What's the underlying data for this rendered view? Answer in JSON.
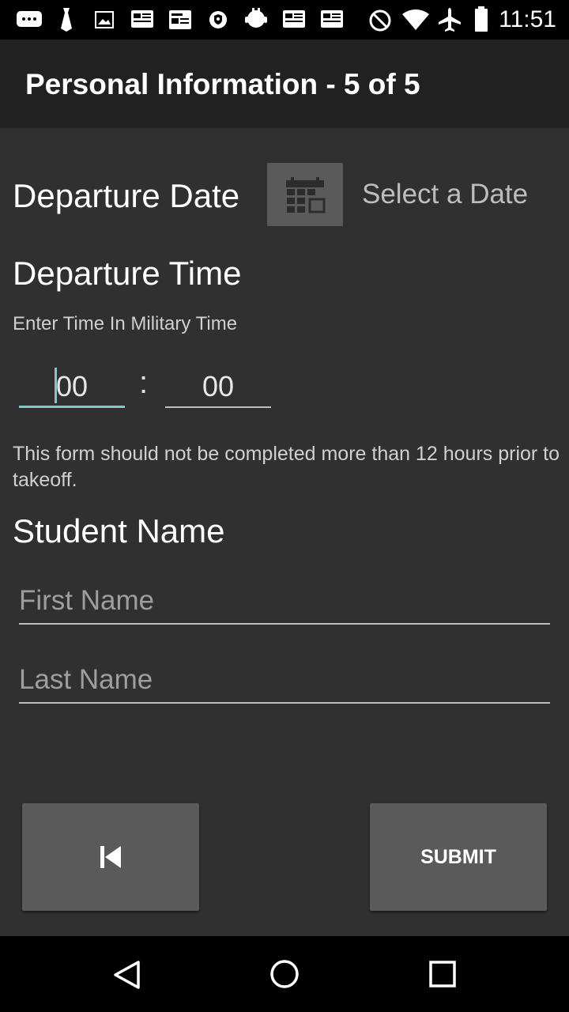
{
  "status_bar": {
    "time": "11:51",
    "icons": [
      "chat-icon",
      "tie-icon",
      "image-icon",
      "news-icon",
      "news-icon",
      "shield-icon",
      "android-icon",
      "news-icon",
      "news-icon",
      "do-not-disturb-icon",
      "wifi-icon",
      "airplane-icon",
      "battery-icon"
    ]
  },
  "header": {
    "title": "Personal Information - 5 of 5"
  },
  "departure_date": {
    "label": "Departure Date",
    "select_text": "Select a Date"
  },
  "departure_time": {
    "label": "Departure Time",
    "hint": "Enter Time In Military Time",
    "hours": "00",
    "separator": ":",
    "minutes": "00"
  },
  "note": "This form should not be completed more than 12 hours prior to takeoff.",
  "student_name": {
    "label": "Student Name",
    "first_placeholder": "First Name",
    "last_placeholder": "Last Name"
  },
  "buttons": {
    "back_icon": "skip-previous-icon",
    "submit": "SUBMIT"
  },
  "colors": {
    "accent": "#80cbc4",
    "background": "#303030",
    "appbar": "#212121",
    "button": "#5a5a5a"
  }
}
